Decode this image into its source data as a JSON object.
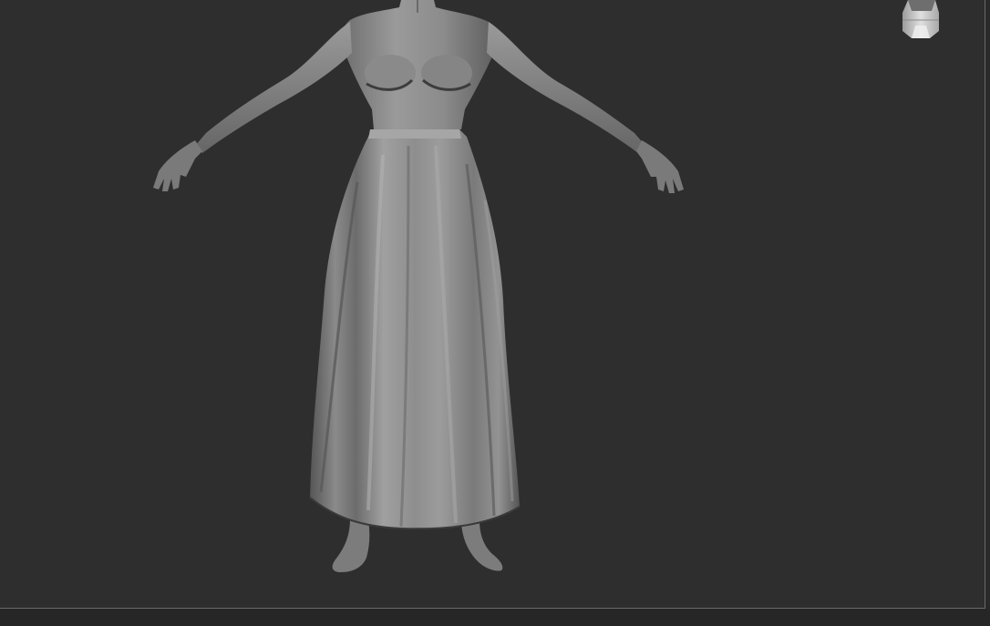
{
  "viewport": {
    "background_color": "#2e2e2e",
    "border_color": "#6a6a6a",
    "model": {
      "icon": "sculpted-female-figure-in-skirt",
      "material_color": "#8f8f8f",
      "shadow_color": "#3a3a3a"
    },
    "navigation_gizmo": {
      "icon": "head-orientation-cube-icon",
      "color": "#c8c8c8"
    }
  }
}
